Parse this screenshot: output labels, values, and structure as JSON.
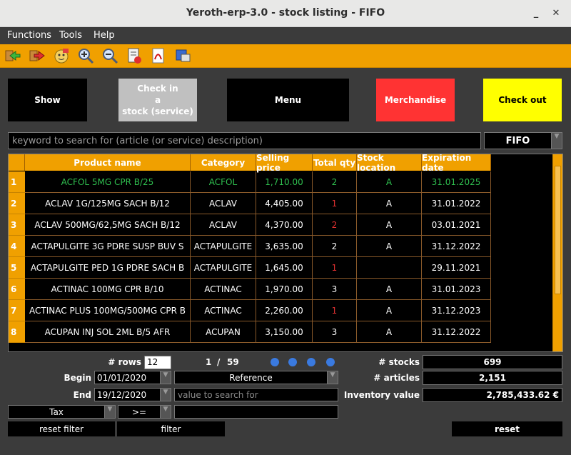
{
  "window": {
    "title": "Yeroth-erp-3.0 - stock listing - FIFO",
    "minimize": "_",
    "close": "✕"
  },
  "menu": [
    "Functions",
    "Tools",
    "Help"
  ],
  "actions": {
    "show": "Show",
    "checkin": [
      "Check in",
      "a",
      "stock (service)"
    ],
    "menu": "Menu",
    "merchandise": "Merchandise",
    "checkout": "Check out"
  },
  "search": {
    "placeholder": "keyword to search for (article (or service) description)",
    "mode": "FIFO"
  },
  "table": {
    "columns": [
      "Product name",
      "Category",
      "Selling price",
      "Total qty",
      "Stock location",
      "Expiration date"
    ],
    "rows": [
      {
        "n": "1",
        "name": "ACFOL 5MG CPR B/25",
        "cat": "ACFOL",
        "price": "1,710.00",
        "qty": "2",
        "loc": "A",
        "exp": "31.01.2025"
      },
      {
        "n": "2",
        "name": "ACLAV 1G/125MG SACH B/12",
        "cat": "ACLAV",
        "price": "4,405.00",
        "qty": "1",
        "loc": "A",
        "exp": "31.01.2022"
      },
      {
        "n": "3",
        "name": "ACLAV 500MG/62,5MG SACH B/12",
        "cat": "ACLAV",
        "price": "4,370.00",
        "qty": "2",
        "loc": "A",
        "exp": "03.01.2021"
      },
      {
        "n": "4",
        "name": "ACTAPULGITE 3G PDRE SUSP BUV S",
        "cat": "ACTAPULGITE",
        "price": "3,635.00",
        "qty": "2",
        "loc": "A",
        "exp": "31.12.2022"
      },
      {
        "n": "5",
        "name": "ACTAPULGITE PED 1G PDRE SACH B",
        "cat": "ACTAPULGITE",
        "price": "1,645.00",
        "qty": "1",
        "loc": "",
        "exp": "29.11.2021"
      },
      {
        "n": "6",
        "name": "ACTINAC 100MG CPR B/10",
        "cat": "ACTINAC",
        "price": "1,970.00",
        "qty": "3",
        "loc": "A",
        "exp": "31.01.2023"
      },
      {
        "n": "7",
        "name": "ACTINAC PLUS 100MG/500MG CPR B",
        "cat": "ACTINAC",
        "price": "2,260.00",
        "qty": "1",
        "loc": "A",
        "exp": "31.12.2023"
      },
      {
        "n": "8",
        "name": "ACUPAN INJ SOL 2ML B/5 AFR",
        "cat": "ACUPAN",
        "price": "3,150.00",
        "qty": "3",
        "loc": "A",
        "exp": "31.12.2022"
      }
    ]
  },
  "pager": {
    "rows_label": "# rows",
    "rows_value": "12",
    "current": "1",
    "sep": "/",
    "total": "59"
  },
  "filters": {
    "begin_label": "Begin",
    "begin": "01/01/2020",
    "end_label": "End",
    "end": "19/12/2020",
    "reference": "Reference",
    "value_placeholder": "value to search for",
    "tax": "Tax",
    "op": ">=",
    "reset_filter": "reset filter",
    "filter": "filter"
  },
  "stats": {
    "stocks_label": "# stocks",
    "stocks": "699",
    "articles_label": "# articles",
    "articles": "2,151",
    "inventory_label": "Inventory value",
    "inventory": "2,785,433.62 €"
  },
  "reset": "reset",
  "colors": {
    "accent": "#f0a000",
    "merchandise": "#ff3333",
    "checkout": "#ffff00",
    "checkin": "#c0c0c0",
    "selected_text": "#2fbf4f",
    "low_qty": "#e03030"
  }
}
